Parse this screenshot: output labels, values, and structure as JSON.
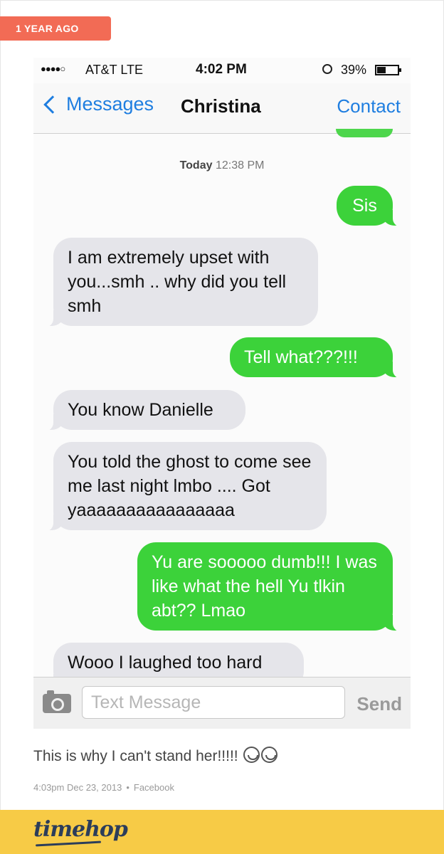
{
  "badge": {
    "label": "1 YEAR AGO"
  },
  "status_bar": {
    "signal": "●●●●○",
    "carrier": "AT&T  LTE",
    "time": "4:02 PM",
    "battery_percent": "39%",
    "battery_level": 0.39
  },
  "nav": {
    "back_label": "Messages",
    "title": "Christina",
    "contact_label": "Contact"
  },
  "thread": {
    "timestamp_day": "Today",
    "timestamp_time": "12:38 PM",
    "messages": [
      {
        "from": "me",
        "text": "Sis"
      },
      {
        "from": "them",
        "text": "I am extremely upset with you...smh .. why did you tell smh"
      },
      {
        "from": "me",
        "text": "Tell what???!!!"
      },
      {
        "from": "them",
        "text": "You know Danielle"
      },
      {
        "from": "them",
        "text": "You told the ghost to come see me last night lmbo .... Got yaaaaaaaaaaaaaaaa"
      },
      {
        "from": "me",
        "text": "Yu are sooooo dumb!!! I was like what the hell Yu tlkin abt?? Lmao"
      },
      {
        "from": "them",
        "text": "Wooo I laughed too hard"
      }
    ]
  },
  "composer": {
    "placeholder": "Text Message",
    "send_label": "Send"
  },
  "post": {
    "caption": "This is why I can't stand her!!!!!",
    "emoji_count": 2,
    "date": "4:03pm Dec 23, 2013",
    "separator": "•",
    "source": "Facebook"
  },
  "footer": {
    "logo": "timehop",
    "color": "#f7cb46"
  },
  "colors": {
    "accent": "#f26b55",
    "ios_blue": "#1f7ee0",
    "bubble_out": "#3cd23a",
    "bubble_in": "#e5e5ea"
  }
}
